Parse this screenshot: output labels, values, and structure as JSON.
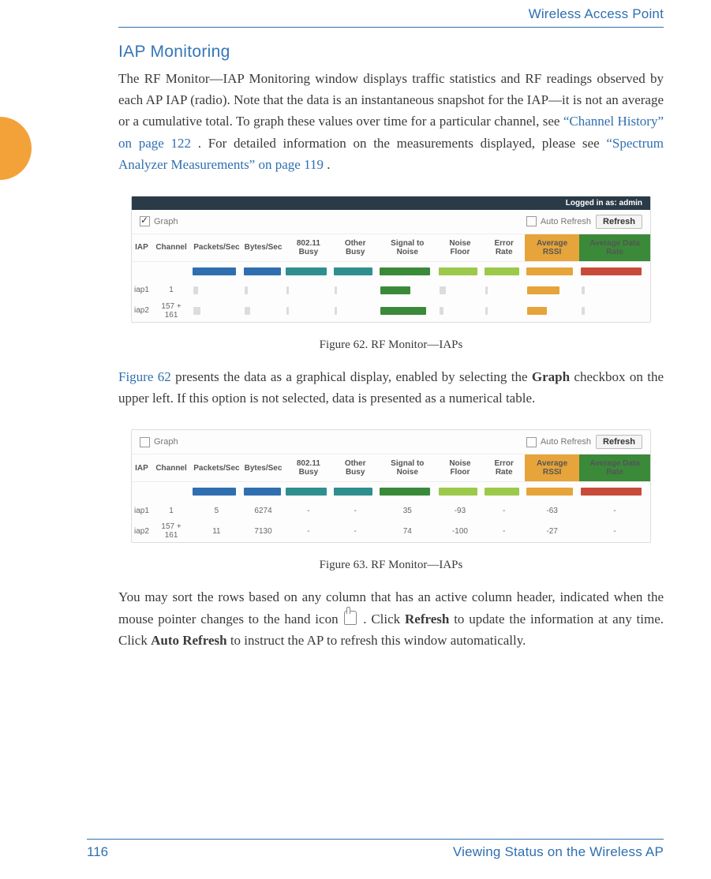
{
  "header": {
    "product": "Wireless Access Point"
  },
  "section": {
    "title": "IAP Monitoring"
  },
  "para1": {
    "t1": "The RF Monitor—IAP Monitoring window displays traffic statistics and RF readings observed by each AP IAP (radio). Note that the data is an instantaneous snapshot for the IAP—it is not an average or a cumulative total. To graph these values over time for a particular channel, see ",
    "link1": "“Channel History” on page 122",
    "t2": ". For detailed information on the measurements displayed, please see ",
    "link2": "“Spectrum Analyzer Measurements” on page 119",
    "t3": "."
  },
  "fig62": {
    "login": "Logged in as: admin",
    "graph_label": "Graph",
    "auto_refresh": "Auto Refresh",
    "refresh": "Refresh",
    "columns": {
      "iap": "IAP",
      "channel": "Channel",
      "pps": "Packets/Sec",
      "bps": "Bytes/Sec",
      "busy": "802.11 Busy",
      "other": "Other Busy",
      "snr": "Signal to Noise",
      "floor": "Noise Floor",
      "err": "Error Rate",
      "rssi": "Average RSSI",
      "rate": "Average Data Rate"
    },
    "rows": [
      {
        "iap": "iap1",
        "channel": "1"
      },
      {
        "iap": "iap2",
        "channel": "157 + 161"
      }
    ],
    "caption": "Figure 62. RF Monitor—IAPs"
  },
  "para2": {
    "link": "Figure 62",
    "t1": " presents the data as a graphical display, enabled by selecting the ",
    "bold": "Graph",
    "t2": " checkbox on the upper left. If this option is not selected, data is presented as a numerical table."
  },
  "fig63": {
    "graph_label": "Graph",
    "auto_refresh": "Auto Refresh",
    "refresh": "Refresh",
    "columns": {
      "iap": "IAP",
      "channel": "Channel",
      "pps": "Packets/Sec",
      "bps": "Bytes/Sec",
      "busy": "802.11 Busy",
      "other": "Other Busy",
      "snr": "Signal to Noise",
      "floor": "Noise Floor",
      "err": "Error Rate",
      "rssi": "Average RSSI",
      "rate": "Average Data Rate"
    },
    "rows": [
      {
        "iap": "iap1",
        "channel": "1",
        "pps": "5",
        "bps": "6274",
        "busy": "-",
        "other": "-",
        "snr": "35",
        "floor": "-93",
        "err": "-",
        "rssi": "-63",
        "rate": "-"
      },
      {
        "iap": "iap2",
        "channel": "157 + 161",
        "pps": "11",
        "bps": "7130",
        "busy": "-",
        "other": "-",
        "snr": "74",
        "floor": "-100",
        "err": "-",
        "rssi": "-27",
        "rate": "-"
      }
    ],
    "caption": "Figure 63. RF Monitor—IAPs"
  },
  "para3": {
    "t1": "You may sort the rows based on any column that has an active column header, indicated when the mouse pointer changes to the hand icon ",
    "t2": ". Click ",
    "b1": "Refresh",
    "t3": " to update the information at any time. Click ",
    "b2": "Auto Refresh",
    "t4": " to instruct the AP to refresh this window automatically."
  },
  "footer": {
    "page": "116",
    "section": "Viewing Status on the Wireless AP"
  },
  "chart_data": [
    {
      "type": "table",
      "title": "RF Monitor — IAPs (graphical bars, Figure 62)",
      "columns": [
        "IAP",
        "Channel",
        "Packets/Sec",
        "Bytes/Sec",
        "802.11 Busy",
        "Other Busy",
        "Signal to Noise",
        "Noise Floor",
        "Error Rate",
        "Average RSSI",
        "Average Data Rate"
      ],
      "note": "Bar widths in the screenshot are qualitative; no numeric labels shown on bars.",
      "rows": [
        {
          "IAP": "iap1",
          "Channel": "1"
        },
        {
          "IAP": "iap2",
          "Channel": "157 + 161"
        }
      ]
    },
    {
      "type": "table",
      "title": "RF Monitor — IAPs (numeric, Figure 63)",
      "columns": [
        "IAP",
        "Channel",
        "Packets/Sec",
        "Bytes/Sec",
        "802.11 Busy",
        "Other Busy",
        "Signal to Noise",
        "Noise Floor",
        "Error Rate",
        "Average RSSI",
        "Average Data Rate"
      ],
      "rows": [
        {
          "IAP": "iap1",
          "Channel": "1",
          "Packets/Sec": 5,
          "Bytes/Sec": 6274,
          "802.11 Busy": "-",
          "Other Busy": "-",
          "Signal to Noise": 35,
          "Noise Floor": -93,
          "Error Rate": "-",
          "Average RSSI": -63,
          "Average Data Rate": "-"
        },
        {
          "IAP": "iap2",
          "Channel": "157 + 161",
          "Packets/Sec": 11,
          "Bytes/Sec": 7130,
          "802.11 Busy": "-",
          "Other Busy": "-",
          "Signal to Noise": 74,
          "Noise Floor": -100,
          "Error Rate": "-",
          "Average RSSI": -27,
          "Average Data Rate": "-"
        }
      ]
    }
  ]
}
